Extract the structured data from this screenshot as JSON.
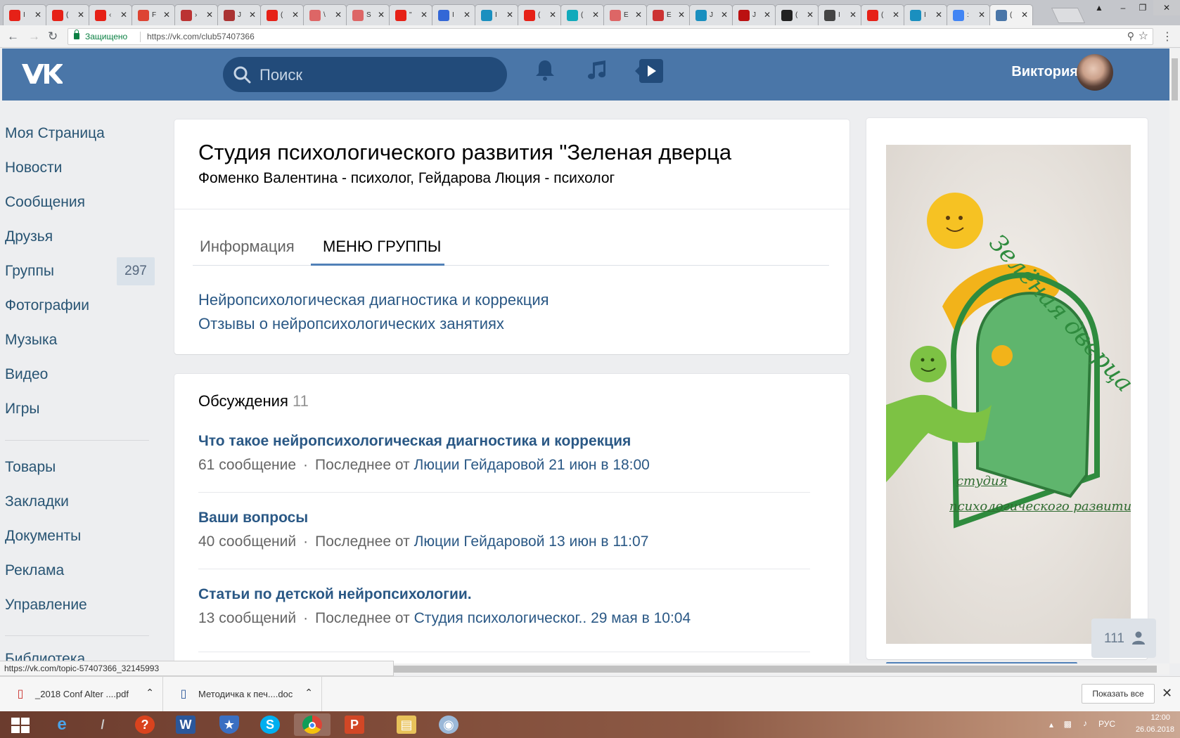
{
  "browser": {
    "tabs": [
      {
        "letter": "I",
        "color": "#e62117"
      },
      {
        "letter": "(",
        "color": "#e62117"
      },
      {
        "letter": "‹",
        "color": "#e62117"
      },
      {
        "letter": "F",
        "color": "#d43"
      },
      {
        "letter": "›",
        "color": "#b33"
      },
      {
        "letter": "J",
        "color": "#a33"
      },
      {
        "letter": "(",
        "color": "#e62117"
      },
      {
        "letter": "\\",
        "color": "#d66"
      },
      {
        "letter": "S",
        "color": "#d66"
      },
      {
        "letter": "\"",
        "color": "#e62117"
      },
      {
        "letter": "I",
        "color": "#3367d6"
      },
      {
        "letter": "I",
        "color": "#1a8fbf"
      },
      {
        "letter": "(",
        "color": "#e62117"
      },
      {
        "letter": "(",
        "color": "#1ab"
      },
      {
        "letter": "E",
        "color": "#d66"
      },
      {
        "letter": "E",
        "color": "#c33"
      },
      {
        "letter": "J",
        "color": "#1a8fbf"
      },
      {
        "letter": "J",
        "color": "#b11"
      },
      {
        "letter": "(",
        "color": "#222"
      },
      {
        "letter": "I",
        "color": "#444"
      },
      {
        "letter": "(",
        "color": "#e62117"
      },
      {
        "letter": "I",
        "color": "#1a8fbf"
      },
      {
        "letter": ":",
        "color": "#4285f4"
      },
      {
        "letter": "(",
        "color": "#4a76a8"
      }
    ],
    "secure_label": "Защищено",
    "url": "https://vk.com/club57407366"
  },
  "header": {
    "search_placeholder": "Поиск",
    "user_name": "Виктория"
  },
  "left_menu": {
    "items": [
      {
        "label": "Моя Страница",
        "count": ""
      },
      {
        "label": "Новости",
        "count": ""
      },
      {
        "label": "Сообщения",
        "count": ""
      },
      {
        "label": "Друзья",
        "count": ""
      },
      {
        "label": "Группы",
        "count": "297"
      },
      {
        "label": "Фотографии",
        "count": ""
      },
      {
        "label": "Музыка",
        "count": ""
      },
      {
        "label": "Видео",
        "count": ""
      },
      {
        "label": "Игры",
        "count": ""
      }
    ],
    "items2": [
      {
        "label": "Товары"
      },
      {
        "label": "Закладки"
      },
      {
        "label": "Документы"
      },
      {
        "label": "Реклама"
      },
      {
        "label": "Управление"
      }
    ],
    "cut_item": "Библиотека"
  },
  "group": {
    "title": "Студия психологического развития \"Зеленая дверца",
    "status": "Фоменко Валентина - психолог, Гейдарова Люция - психолог",
    "tabs": [
      "Информация",
      "МЕНЮ ГРУППЫ"
    ],
    "menu_links": [
      "Нейропсихологическая диагностика и коррекция",
      "Отзывы о нейропсихологических занятиях"
    ]
  },
  "discussions": {
    "title": "Обсуждения",
    "count": "11",
    "topics": [
      {
        "title": "Что такое нейропсихологическая диагностика и коррекция",
        "count": "61 сообщение",
        "last_prefix": "Последнее от",
        "author": "Люции Гейдаровой",
        "date": "21 июн в 18:00"
      },
      {
        "title": "Ваши вопросы",
        "count": "40 сообщений",
        "last_prefix": "Последнее от",
        "author": "Люции Гейдаровой",
        "date": "13 июн в 11:07"
      },
      {
        "title": "Статьи по детской нейропсихологии.",
        "count": "13 сообщений",
        "last_prefix": "Последнее от",
        "author": "Студия психологическог..",
        "date": "29 мая в 10:04"
      }
    ]
  },
  "cover": {
    "text_top": "Зелёная дверца",
    "text_bottom_1": "студия",
    "text_bottom_2": "психологического развити"
  },
  "members": "111",
  "status_bar_url": "https://vk.com/topic-57407366_32145993",
  "downloads": [
    {
      "name": "_2018 Conf Alter ....pdf"
    },
    {
      "name": "Методичка к печ....doc"
    }
  ],
  "downloads_show_all": "Показать все",
  "tray": {
    "lang": "РУС",
    "time": "12:00",
    "date": "26.06.2018"
  },
  "colors": {
    "vk_blue": "#4a76a8",
    "link": "#2a5885",
    "bg": "#edeef0"
  }
}
